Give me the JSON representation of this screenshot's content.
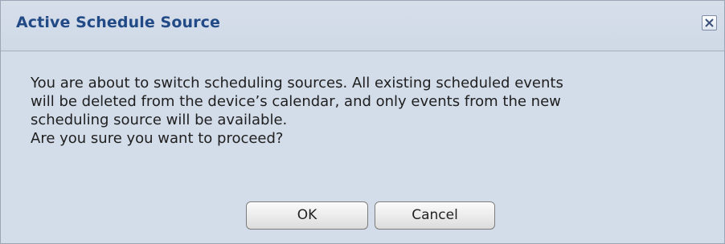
{
  "dialog": {
    "title": "Active Schedule Source",
    "close_icon": "close-icon",
    "message_lines": [
      "You are about to switch scheduling sources. All existing scheduled events",
      "will be deleted from the device’s calendar, and only events from the new",
      "scheduling source will be available.",
      "Are you sure you want to proceed?"
    ],
    "ok_label": "OK",
    "cancel_label": "Cancel"
  },
  "colors": {
    "title_text": "#214a86",
    "background": "#d3dce9",
    "close_x": "#3a4f7a"
  }
}
